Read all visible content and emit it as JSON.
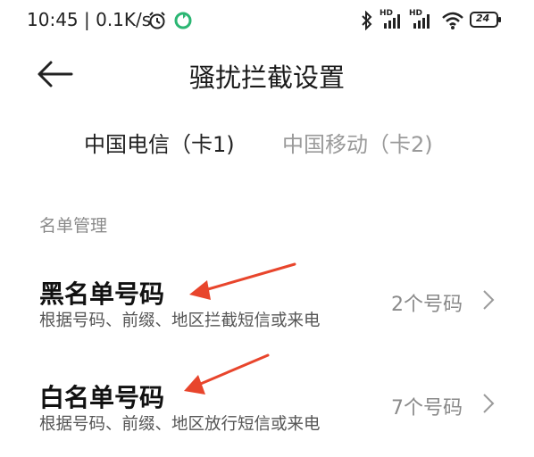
{
  "status_bar": {
    "text": "10:45 | 0.1K/s",
    "network_1": "HD",
    "network_2": "HD",
    "battery": "24"
  },
  "header": {
    "title": "骚扰拦截设置"
  },
  "tabs": [
    {
      "label": "中国电信（卡1)",
      "active": true
    },
    {
      "label": "中国移动（卡2)",
      "active": false
    }
  ],
  "section": {
    "title": "名单管理"
  },
  "rows": [
    {
      "title": "黑名单号码",
      "subtitle": "根据号码、前缀、地区拦截短信或来电",
      "count": "2个号码"
    },
    {
      "title": "白名单号码",
      "subtitle": "根据号码、前缀、地区放行短信或来电",
      "count": "7个号码"
    }
  ],
  "colors": {
    "annotation_arrow": "#e8452c",
    "accent_green": "#2bb673"
  }
}
